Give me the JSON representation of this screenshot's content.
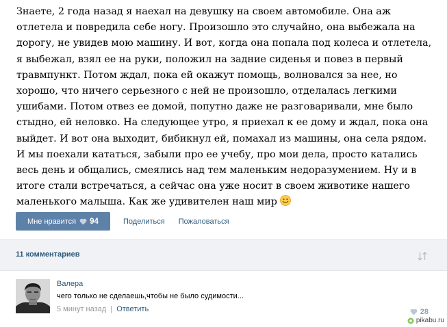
{
  "post": {
    "text": "Знаете, 2 года назад я наехал на девушку на своем автомобиле. Она аж отлетела и повредила себе ногу. Произошло это случайно, она выбежала на дорогу, не увидев мою машину. И вот, когда она попала под колеса и отлетела, я выбежал, взял ее на руки, положил на задние сиденья и повез в первый травмпункт. Потом ждал, пока ей окажут помощь, волновался за нее, но хорошо, что ничего серьезного с ней не произошло, отделалась легкими ушибами. Потом отвез ее домой, попутно даже не разговаривали, мне было стыдно, ей неловко. На следующее утро, я приехал к ее дому и ждал, пока она выйдет. И вот она выходит, бибикнул ей, помахал из машины, она села рядом. И мы поехали кататься, забыли про ее учебу, про мои дела, просто катались весь день и общались, смеялись над тем маленьким недоразумением. Ну и в итоге стали встречаться, а сейчас она уже носит в своем животике нашего маленького малыша. Как же удивителен наш мир",
    "emoji": "smile-emoji"
  },
  "actions": {
    "like_label": "Мне нравится",
    "like_count": "94",
    "share_label": "Поделиться",
    "complain_label": "Пожаловаться"
  },
  "comments": {
    "count_label": "11 комментариев",
    "sort_icon": "sort-arrows-icon",
    "items": [
      {
        "author": "Валера",
        "text": "чего только не сделаешь,чтобы не было судимости...",
        "time": "5 минут назад",
        "separator": "|",
        "reply_label": "Ответить",
        "like_count": "28"
      }
    ]
  },
  "watermark": "pikabu.ru",
  "colors": {
    "link": "#2b587a",
    "like_button": "#5e81a8",
    "header_bg": "#f0f2f5",
    "muted": "#999999"
  }
}
